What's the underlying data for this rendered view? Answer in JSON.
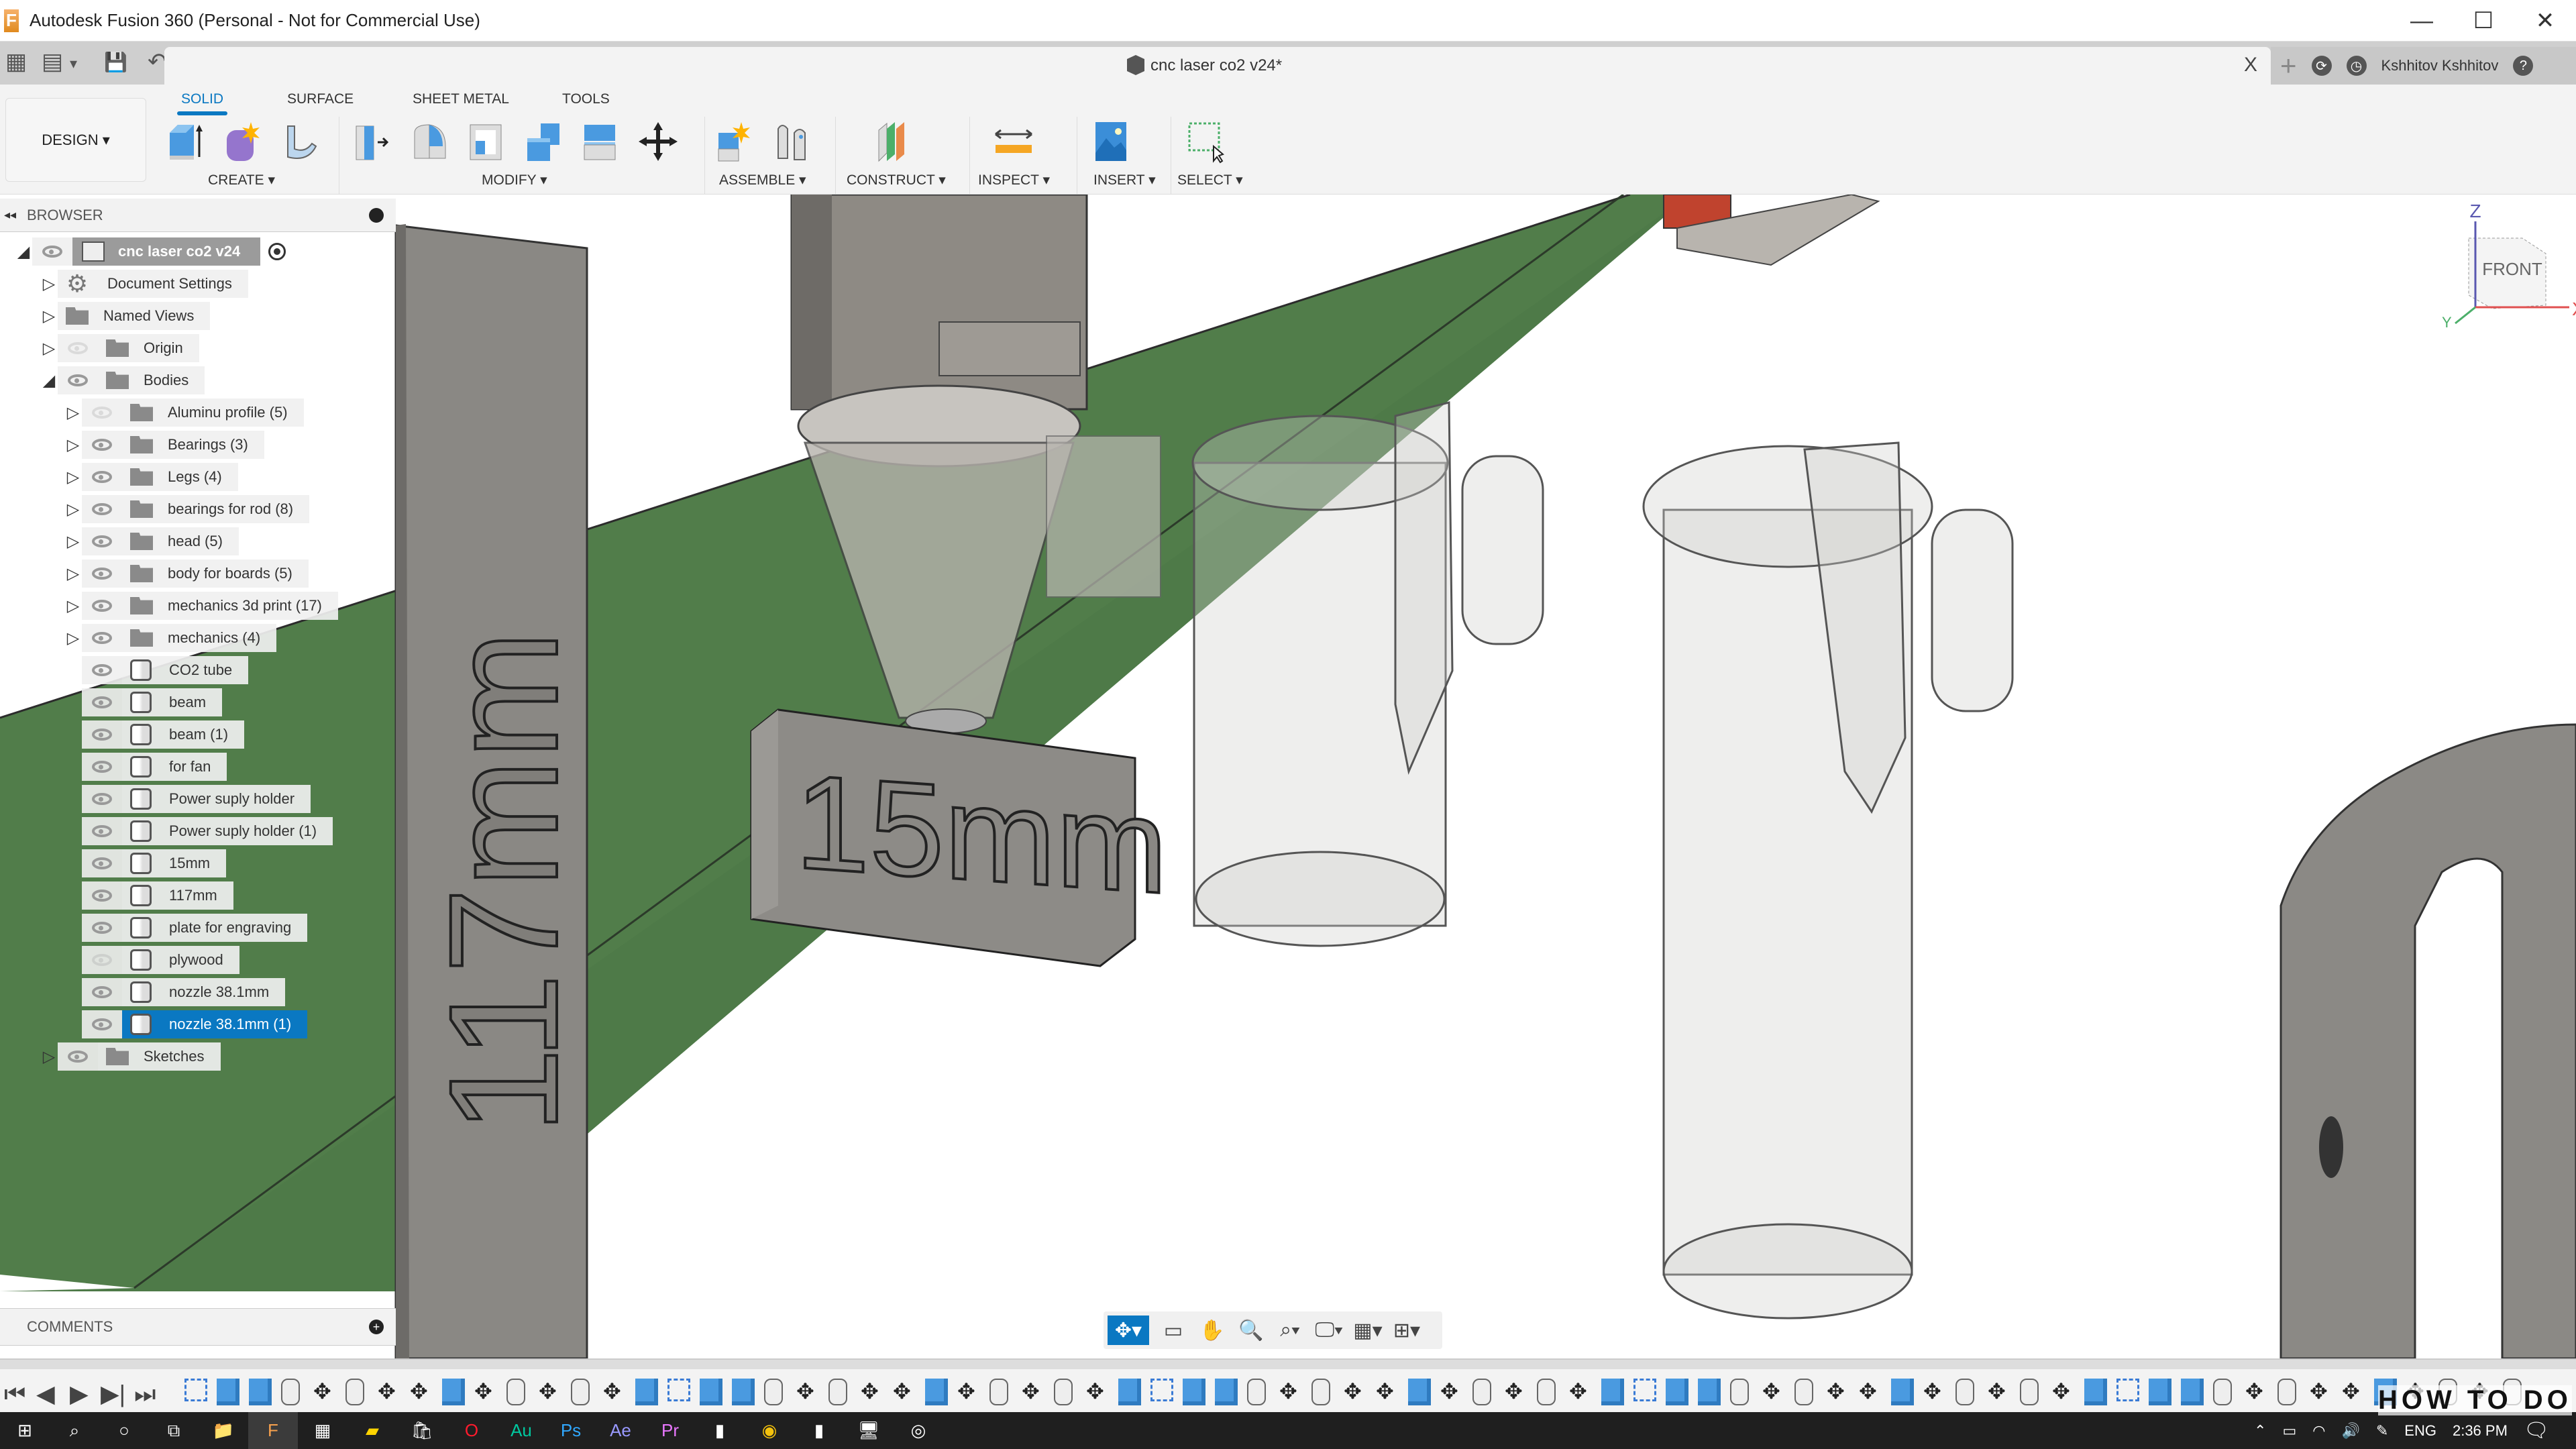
{
  "window": {
    "title": "Autodesk Fusion 360 (Personal - Not for Commercial Use)",
    "app_icon": "F",
    "controls": {
      "minimize": "—",
      "maximize": "☐",
      "close": "✕"
    }
  },
  "quick_access": {
    "grid_icon": "▦",
    "file_icon": "▤",
    "save_icon": "💾",
    "undo_icon": "↶",
    "redo_icon": "↷",
    "dropdown": "▾"
  },
  "document_tab": {
    "name": "cnc laser co2 v24*",
    "close": "X"
  },
  "header_right": {
    "new_tab": "+",
    "job_status_icon": "⟳",
    "history_icon": "◷",
    "user_name": "Kshhitov Kshhitov",
    "help_icon": "?"
  },
  "ribbon": {
    "workspace": "DESIGN ▾",
    "tabs": [
      {
        "label": "SOLID",
        "active": true
      },
      {
        "label": "SURFACE",
        "active": false
      },
      {
        "label": "SHEET METAL",
        "active": false
      },
      {
        "label": "TOOLS",
        "active": false
      }
    ],
    "groups": [
      {
        "label": "CREATE ▾",
        "tools": [
          "new-component",
          "create-form",
          "sweep"
        ]
      },
      {
        "label": "MODIFY ▾",
        "tools": [
          "press-pull",
          "fillet",
          "shell",
          "combine",
          "split",
          "move"
        ]
      },
      {
        "label": "ASSEMBLE ▾",
        "tools": [
          "new-component",
          "joint"
        ]
      },
      {
        "label": "CONSTRUCT ▾",
        "tools": [
          "offset-plane"
        ]
      },
      {
        "label": "INSPECT ▾",
        "tools": [
          "measure"
        ]
      },
      {
        "label": "INSERT ▾",
        "tools": [
          "insert-image"
        ]
      },
      {
        "label": "SELECT ▾",
        "tools": [
          "window-select"
        ]
      }
    ]
  },
  "browser": {
    "title": "BROWSER",
    "root": "cnc laser co2 v24",
    "items": [
      {
        "label": "Document Settings",
        "type": "settings",
        "level": 1,
        "expand": "▷",
        "visible": null
      },
      {
        "label": "Named Views",
        "type": "folder",
        "level": 1,
        "expand": "▷",
        "visible": null
      },
      {
        "label": "Origin",
        "type": "folder",
        "level": 1,
        "expand": "▷",
        "visible": false
      },
      {
        "label": "Bodies",
        "type": "folder",
        "level": 1,
        "expand": "◢",
        "visible": true
      },
      {
        "label": "Aluminu profile (5)",
        "type": "folder",
        "level": 2,
        "expand": "▷",
        "visible": false
      },
      {
        "label": "Bearings (3)",
        "type": "folder",
        "level": 2,
        "expand": "▷",
        "visible": true
      },
      {
        "label": "Legs (4)",
        "type": "folder",
        "level": 2,
        "expand": "▷",
        "visible": true
      },
      {
        "label": "bearings for rod (8)",
        "type": "folder",
        "level": 2,
        "expand": "▷",
        "visible": true
      },
      {
        "label": "head (5)",
        "type": "folder",
        "level": 2,
        "expand": "▷",
        "visible": true
      },
      {
        "label": "body for boards (5)",
        "type": "folder",
        "level": 2,
        "expand": "▷",
        "visible": true
      },
      {
        "label": "mechanics 3d print (17)",
        "type": "folder",
        "level": 2,
        "expand": "▷",
        "visible": true
      },
      {
        "label": "mechanics (4)",
        "type": "folder",
        "level": 2,
        "expand": "▷",
        "visible": true
      },
      {
        "label": "CO2 tube",
        "type": "body",
        "level": 2,
        "expand": "",
        "visible": true
      },
      {
        "label": "beam",
        "type": "body",
        "level": 2,
        "expand": "",
        "visible": true
      },
      {
        "label": "beam (1)",
        "type": "body",
        "level": 2,
        "expand": "",
        "visible": true
      },
      {
        "label": "for fan",
        "type": "body",
        "level": 2,
        "expand": "",
        "visible": true
      },
      {
        "label": "Power suply holder",
        "type": "body",
        "level": 2,
        "expand": "",
        "visible": true
      },
      {
        "label": "Power suply holder (1)",
        "type": "body",
        "level": 2,
        "expand": "",
        "visible": true
      },
      {
        "label": "15mm",
        "type": "body",
        "level": 2,
        "expand": "",
        "visible": true
      },
      {
        "label": "117mm",
        "type": "body",
        "level": 2,
        "expand": "",
        "visible": true
      },
      {
        "label": "plate for engraving",
        "type": "body",
        "level": 2,
        "expand": "",
        "visible": true
      },
      {
        "label": "plywood",
        "type": "body",
        "level": 2,
        "expand": "",
        "visible": false
      },
      {
        "label": "nozzle 38.1mm",
        "type": "body",
        "level": 2,
        "expand": "",
        "visible": true
      },
      {
        "label": "nozzle 38.1mm (1)",
        "type": "body",
        "level": 2,
        "expand": "",
        "visible": true,
        "selected": true
      },
      {
        "label": "Sketches",
        "type": "folder",
        "level": 1,
        "expand": "▷",
        "visible": true
      }
    ]
  },
  "comments": {
    "title": "COMMENTS",
    "add": "+"
  },
  "viewport": {
    "engraved_texts": [
      "15mm",
      "117mm"
    ],
    "viewcube": {
      "face": "FRONT",
      "axes": [
        "Z",
        "X",
        "Y"
      ]
    }
  },
  "nav_bar": {
    "tools": [
      "orbit",
      "look-at",
      "pan",
      "zoom",
      "fit",
      "display-settings",
      "grid-snaps",
      "viewports"
    ]
  },
  "timeline": {
    "controls": [
      "⏮",
      "◀",
      "▶",
      "▶|",
      "⏭"
    ]
  },
  "taskbar": {
    "apps": [
      "start",
      "search",
      "cortana",
      "task-view",
      "file-explorer",
      "fusion-360",
      "calculator",
      "sticky-notes",
      "store",
      "opera",
      "audition",
      "photoshop",
      "after-effects",
      "premiere",
      "app",
      "chrome",
      "app",
      "remote-desktop",
      "obs"
    ],
    "tray": {
      "language": "ENG",
      "time": "2:36 PM"
    }
  },
  "watermark": "HOW TO DO",
  "colors": {
    "accent": "#0a78c2",
    "green_plate": "#4e7a48",
    "gray_body": "#8e8c88"
  }
}
